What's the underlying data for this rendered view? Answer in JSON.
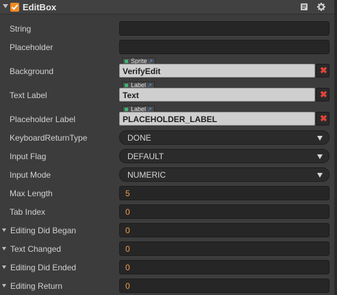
{
  "component": {
    "title": "EditBox",
    "enabled": true,
    "icons": [
      "book-icon",
      "gear-icon"
    ]
  },
  "props": {
    "string": {
      "label": "String",
      "value": ""
    },
    "placeholder": {
      "label": "Placeholder",
      "value": ""
    },
    "background": {
      "label": "Background",
      "type_tag": "Sprite",
      "value": "VerifyEdit",
      "clear": "✖"
    },
    "text_label": {
      "label": "Text Label",
      "type_tag": "Label",
      "value": "Text",
      "clear": "✖"
    },
    "placeholder_label": {
      "label": "Placeholder Label",
      "type_tag": "Label",
      "value": "PLACEHOLDER_LABEL",
      "clear": "✖"
    },
    "keyboard_return_type": {
      "label": "KeyboardReturnType",
      "value": "DONE"
    },
    "input_flag": {
      "label": "Input Flag",
      "value": "DEFAULT"
    },
    "input_mode": {
      "label": "Input Mode",
      "value": "NUMERIC"
    },
    "max_length": {
      "label": "Max Length",
      "value": "5"
    },
    "tab_index": {
      "label": "Tab Index",
      "value": "0"
    }
  },
  "events": {
    "editing_did_began": {
      "label": "Editing Did Began",
      "value": "0"
    },
    "text_changed": {
      "label": "Text Changed",
      "value": "0"
    },
    "editing_did_ended": {
      "label": "Editing Did Ended",
      "value": "0"
    },
    "editing_return": {
      "label": "Editing Return",
      "value": "0"
    }
  },
  "colors": {
    "accent": "#f08a24",
    "number_value": "#f0a04b",
    "clear_button": "#e0453a"
  }
}
